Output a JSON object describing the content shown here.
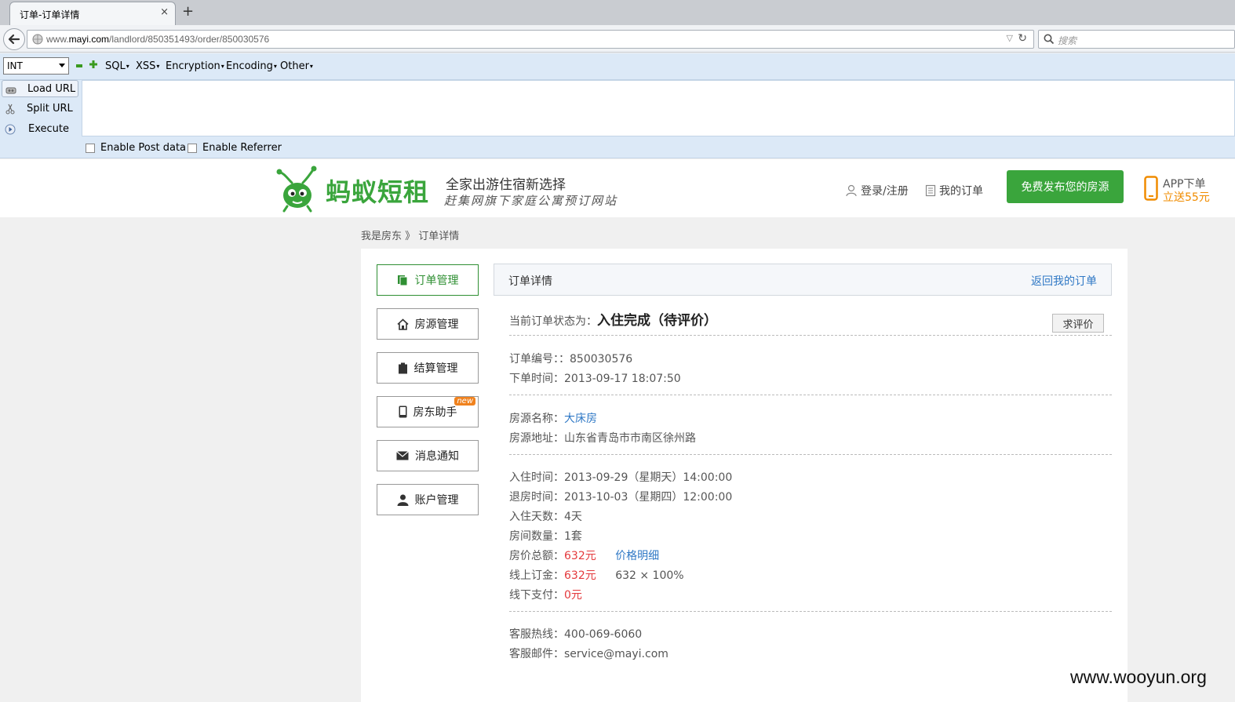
{
  "browser": {
    "tab_title": "订单-订单详情",
    "tab_close": "×",
    "new_tab": "+",
    "url_prefix": "www.",
    "url_domain": "mayi.com",
    "url_path": "/landlord/850351493/order/850030576",
    "search_placeholder": "搜索"
  },
  "hackbar": {
    "type_select": "INT",
    "menus": [
      "SQL",
      "XSS",
      "Encryption",
      "Encoding",
      "Other"
    ],
    "buttons": [
      "Load URL",
      "Split URL",
      "Execute"
    ],
    "options": [
      "Enable Post data",
      "Enable Referrer"
    ]
  },
  "site": {
    "logo_text": "蚂蚁短租",
    "slogan": "全家出游住宿新选择",
    "slogan_sub": "赶集网旗下家庭公寓预订网站",
    "login": "登录/注册",
    "my_orders": "我的订单",
    "publish": "免费发布您的房源",
    "app_line1": "APP下单",
    "app_line2": "立送55元",
    "brand_color": "#3aa53c"
  },
  "breadcrumb": {
    "home": "我是房东",
    "sep": " 》",
    "current": "订单详情"
  },
  "sidebar": [
    {
      "label": "订单管理",
      "icon": "orders-icon",
      "active": true
    },
    {
      "label": "房源管理",
      "icon": "house-icon"
    },
    {
      "label": "结算管理",
      "icon": "clipboard-icon"
    },
    {
      "label": "房东助手",
      "icon": "phone-icon",
      "badge": "new"
    },
    {
      "label": "消息通知",
      "icon": "mail-icon"
    },
    {
      "label": "账户管理",
      "icon": "user-icon"
    }
  ],
  "panel": {
    "title": "订单详情",
    "back_link": "返回我的订单"
  },
  "order": {
    "status_label": "当前订单状态为：",
    "status_value": "入住完成（待评价）",
    "review_button": "求评价",
    "number_label": "订单编号：",
    "number_value": "：850030576",
    "time_label": "下单时间：",
    "time_value": "2013-09-17 18:07:50",
    "room_name_label": "房源名称：",
    "room_name_value": "大床房",
    "room_addr_label": "房源地址：",
    "room_addr_value": "山东省青岛市市南区徐州路",
    "checkin_label": "入住时间：",
    "checkin_value": "2013-09-29（星期天）14:00:00",
    "checkout_label": "退房时间：",
    "checkout_value": "2013-10-03（星期四）12:00:00",
    "days_label": "入住天数：",
    "days_value": "4天",
    "rooms_label": "房间数量：",
    "rooms_value": "1套",
    "total_label": "房价总额：",
    "total_value": "632元",
    "price_detail": "价格明细",
    "deposit_label": "线上订金：",
    "deposit_value": "632元",
    "deposit_formula": "632 × 100%",
    "offline_label": "线下支付：",
    "offline_value": "0元",
    "hotline_label": "客服热线：",
    "hotline_value": "400-069-6060",
    "email_label": "客服邮件：",
    "email_value": "service@mayi.com"
  },
  "watermark": "www.wooyun.org"
}
